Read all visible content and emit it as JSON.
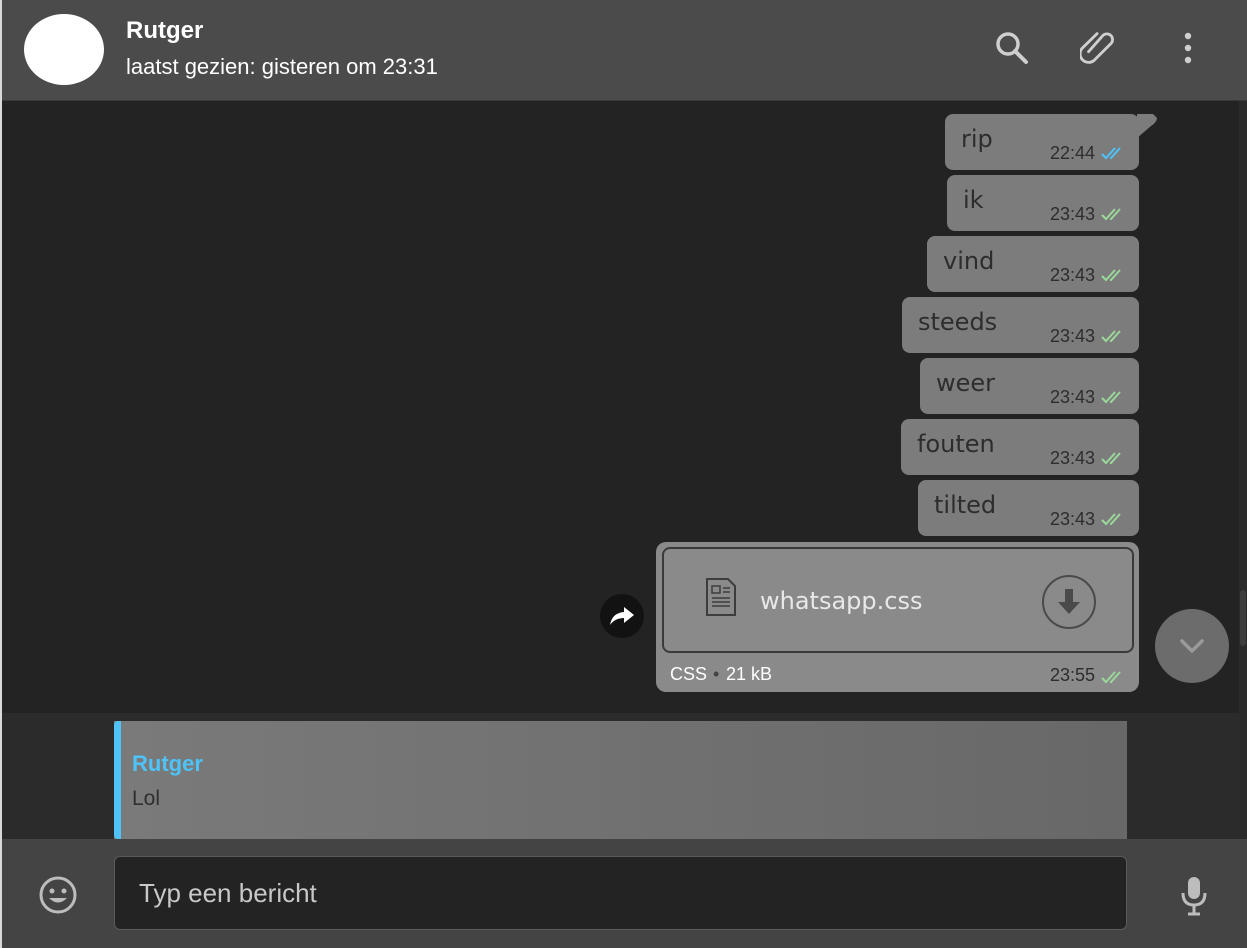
{
  "header": {
    "contact_name": "Rutger",
    "status": "laatst gezien: gisteren om 23:31",
    "icons": [
      "search-icon",
      "attach-icon",
      "menu-icon"
    ]
  },
  "messages": [
    {
      "text": "rip",
      "time": "22:44",
      "read": true
    },
    {
      "text": "ik",
      "time": "23:43",
      "read": false
    },
    {
      "text": "vind",
      "time": "23:43",
      "read": false
    },
    {
      "text": "steeds",
      "time": "23:43",
      "read": false
    },
    {
      "text": "weer",
      "time": "23:43",
      "read": false
    },
    {
      "text": "fouten",
      "time": "23:43",
      "read": false
    },
    {
      "text": "tilted",
      "time": "23:43",
      "read": false
    }
  ],
  "file_message": {
    "filename": "whatsapp.css",
    "type": "CSS",
    "separator": "•",
    "size": "21 kB",
    "time": "23:55"
  },
  "reply": {
    "name": "Rutger",
    "text": "Lol"
  },
  "composer": {
    "placeholder": "Typ een bericht"
  },
  "colors": {
    "read_ticks": "#4fc3f7",
    "sent_ticks": "#9bd79b",
    "accent": "#4fc3f7"
  }
}
